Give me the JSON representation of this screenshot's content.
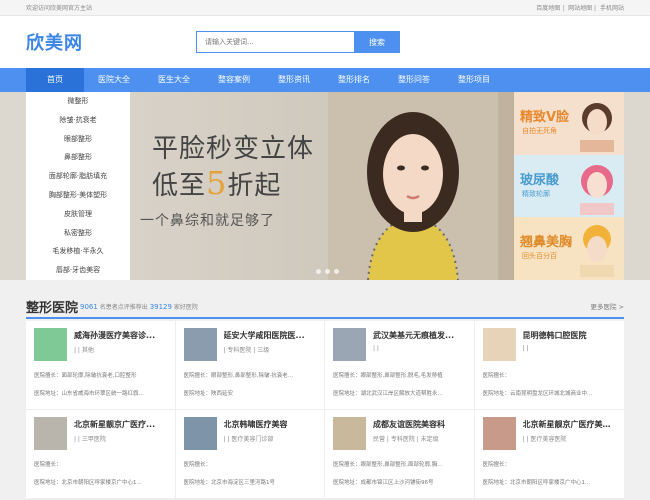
{
  "topbar": {
    "welcome": "欢迎访问欣美网官方主站",
    "links": [
      "百度地图",
      "网站地图",
      "手机网站"
    ]
  },
  "header": {
    "logo": "欣美网",
    "search_placeholder": "请输入关键词...",
    "search_button": "搜索"
  },
  "nav": [
    "首页",
    "医院大全",
    "医生大全",
    "整容案例",
    "整形资讯",
    "整形排名",
    "整形问答",
    "整形项目"
  ],
  "left_menu": [
    "微整形",
    "除皱·抗衰老",
    "眼部整形",
    "鼻部整形",
    "面部轮廓·脂肪填充",
    "胸部整形·美体塑形",
    "皮肤管理",
    "私密整形",
    "毛发移植·半永久",
    "唇部·牙齿美容"
  ],
  "hero": {
    "line1": "平脸秒变立体",
    "line2_a": "低至",
    "line2_hl": "5",
    "line2_b": "折起",
    "line3": "一个鼻综和就足够了"
  },
  "ads": [
    {
      "title": "精致V脸",
      "sub": "自拍无死角",
      "color": "#e9892f",
      "bg": "#f4e0cc"
    },
    {
      "title": "玻尿酸",
      "sub": "精致轮廓",
      "color": "#4a9bd0",
      "bg": "#d9ecf3"
    },
    {
      "title": "翘鼻美胸",
      "sub": "回头百分百",
      "color": "#e08c2c",
      "bg": "#f7e3c2"
    }
  ],
  "section": {
    "title": "整形医院",
    "stat_prefix": "9061",
    "stat_mid": "名患者点评推荐出",
    "stat_num": "39129",
    "stat_suffix": "家好医院",
    "more": "更多医院 >"
  },
  "hospitals": [
    {
      "name": "威海孙漫医疗美容诊...",
      "tag": "| | 其他",
      "l1": "医院擅长：面部轮廓,除皱抗衰老,口腔整形",
      "l2": "医院地址：山东省威海市环翠区统一路红旗...",
      "thumb": "#7fc996"
    },
    {
      "name": "延安大学咸阳医院医...",
      "tag": "| 专科医院 | 三级",
      "l1": "医院擅长：眼部整形,鼻部整形,除皱·抗衰老...",
      "l2": "医院地址：陕西延安",
      "thumb": "#8a9cae"
    },
    {
      "name": "武汉美基元无痕植发...",
      "tag": "| |",
      "l1": "医院擅长：眼部整形,鼻部整形,脱毛,毛发移植",
      "l2": "医院地址：湖北武汉江岸区解放大道帮胜永...",
      "thumb": "#9aa6b4"
    },
    {
      "name": "昆明德韩口腔医院",
      "tag": "| |",
      "l1": "医院擅长：",
      "l2": "医院地址：云南昆明盘龙区环城北城商业中...",
      "thumb": "#e6d3b8"
    },
    {
      "name": "北京新星靓京广医疗...",
      "tag": "| | 三甲医院",
      "l1": "医院擅长：",
      "l2": "医院地址：北京市朝阳区呼家楼京广中心1...",
      "thumb": "#b9b5ad"
    },
    {
      "name": "北京韩啸医疗美容",
      "tag": "| | 医疗美容门诊部",
      "l1": "医院擅长：",
      "l2": "医院地址：北京市海淀区三里河路1号",
      "thumb": "#7e94a8"
    },
    {
      "name": "成都友谊医院美容科",
      "tag": "民营 | 专科医院 | 未定级",
      "l1": "医院擅长：眼部整形,鼻部整形,面部轮廓,胸...",
      "l2": "医院地址：成都市锦江区上沙河铺街96号",
      "thumb": "#c9b99c"
    },
    {
      "name": "北京新星靓京广医疗美容诊...",
      "tag": "| | 医疗美容医院",
      "l1": "医院擅长：",
      "l2": "医院地址：北京市朝阳区呼家楼京广中心1...",
      "thumb": "#c79a8a"
    }
  ]
}
